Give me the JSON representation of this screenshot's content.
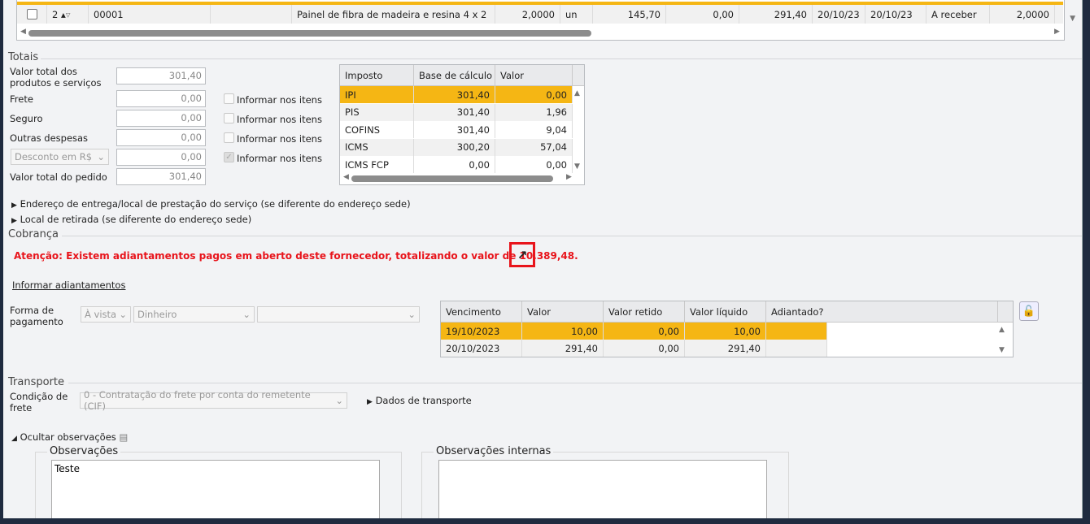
{
  "items_table": {
    "row": [
      "",
      "2",
      "00001",
      "",
      "Painel de fibra de madeira e resina 4 x 2",
      "2,0000",
      "un",
      "145,70",
      "0,00",
      "291,40",
      "20/10/23",
      "20/10/23",
      "A receber",
      "2,0000"
    ]
  },
  "totais": {
    "title": "Totais",
    "valor_total_label": "Valor total dos produtos e serviços",
    "valor_total": "301,40",
    "frete_label": "Frete",
    "frete": "0,00",
    "seguro_label": "Seguro",
    "seguro": "0,00",
    "outras_label": "Outras despesas",
    "outras": "0,00",
    "desconto_select": "Desconto em R$",
    "desconto": "0,00",
    "pedido_label": "Valor total do pedido",
    "pedido": "301,40",
    "informar": "Informar nos itens"
  },
  "impostos": {
    "headers": [
      "Imposto",
      "Base de cálculo",
      "Valor"
    ],
    "rows": [
      [
        "IPI",
        "301,40",
        "0,00"
      ],
      [
        "PIS",
        "301,40",
        "1,96"
      ],
      [
        "COFINS",
        "301,40",
        "9,04"
      ],
      [
        "ICMS",
        "300,20",
        "57,04"
      ],
      [
        "ICMS FCP",
        "0,00",
        "0,00"
      ]
    ]
  },
  "endereco_entrega": "Endereço de entrega/local de prestação do serviço (se diferente do endereço sede)",
  "local_retirada": "Local de retirada (se diferente do endereço sede)",
  "cobranca": {
    "title": "Cobrança",
    "alert": "Atenção: Existem adiantamentos pagos em aberto deste fornecedor, totalizando o valor de 10.389,48.",
    "informar_link": "Informar adiantamentos",
    "forma_label": "Forma de pagamento",
    "forma1": "À vista",
    "forma2": "Dinheiro",
    "forma3": "",
    "alert_color": "#e8141b"
  },
  "parcelas": {
    "headers": [
      "Vencimento",
      "Valor",
      "Valor retido",
      "Valor líquido",
      "Adiantado?"
    ],
    "rows": [
      [
        "19/10/2023",
        "10,00",
        "0,00",
        "10,00",
        ""
      ],
      [
        "20/10/2023",
        "291,40",
        "0,00",
        "291,40",
        ""
      ]
    ]
  },
  "transporte": {
    "title": "Transporte",
    "condicao_label": "Condição de frete",
    "condicao": "0 - Contratação do frete por conta do remetente (CIF)",
    "dados": "Dados de transporte"
  },
  "observacoes": {
    "toggle": "Ocultar observações",
    "obs_title": "Observações",
    "obs_value": "Teste",
    "int_title": "Observações internas",
    "int_value": ""
  }
}
